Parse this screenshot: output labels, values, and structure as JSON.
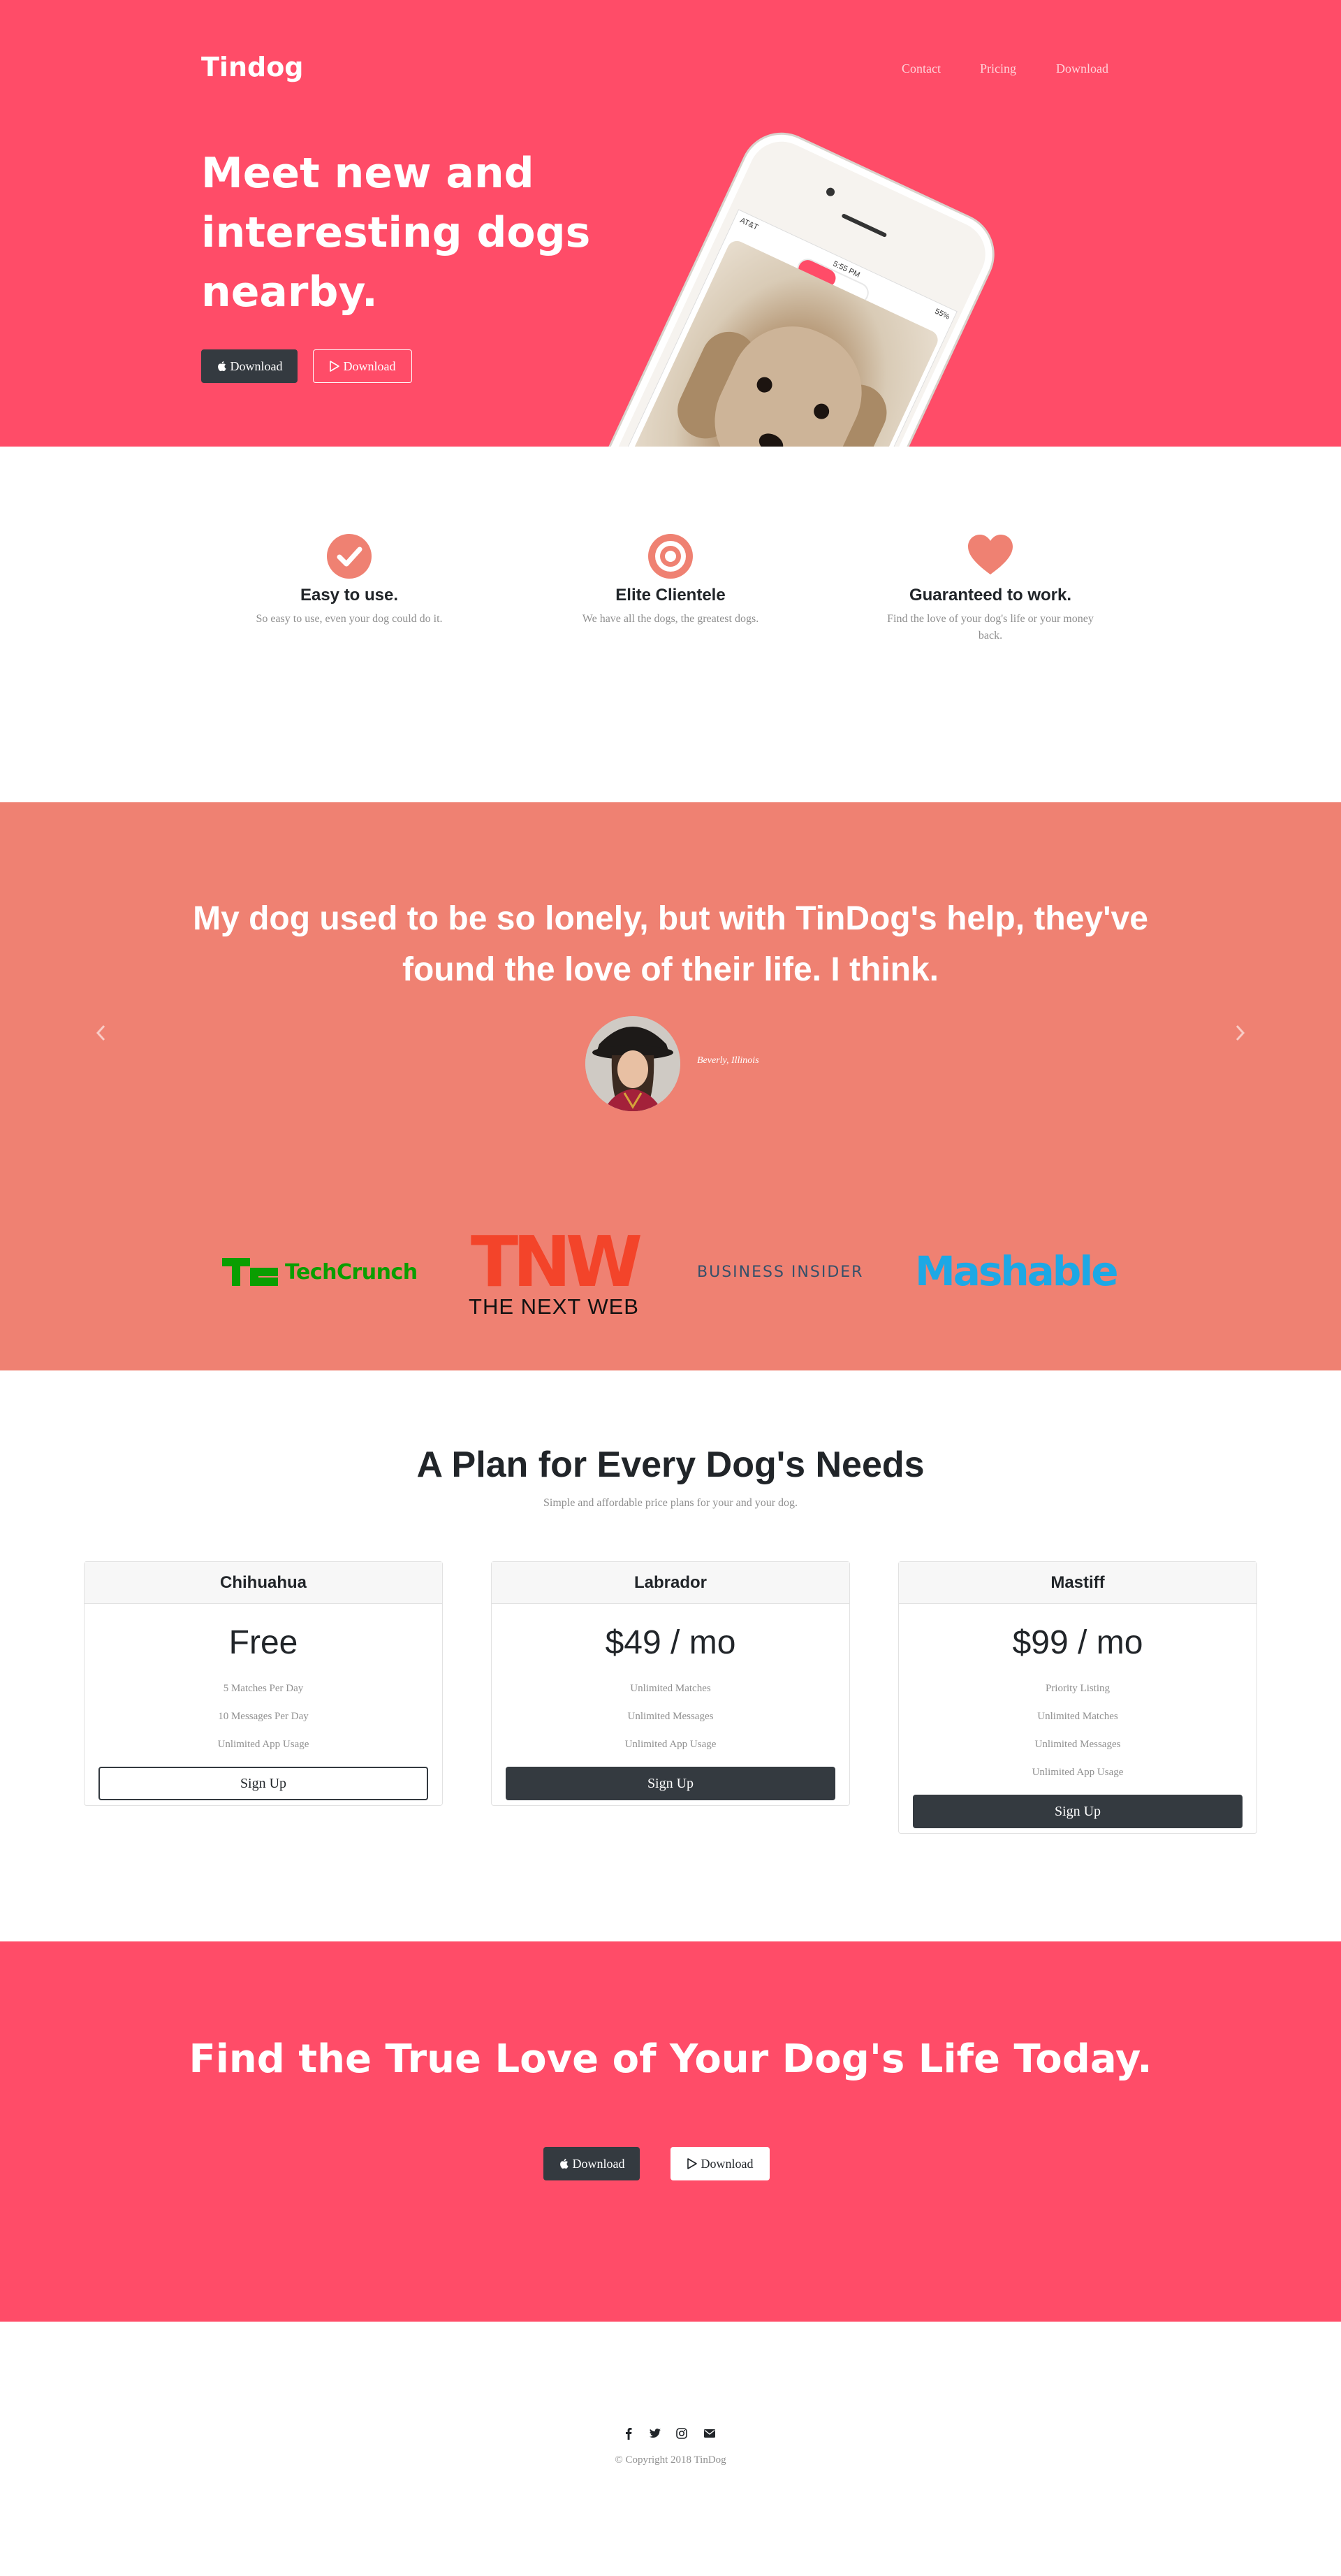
{
  "brand": "Tindog",
  "nav": {
    "contact": "Contact",
    "pricing": "Pricing",
    "download": "Download"
  },
  "hero": {
    "heading": "Meet new and interesting dogs nearby.",
    "download_apple": "Download",
    "download_play": "Download"
  },
  "phone": {
    "carrier": "AT&T",
    "time": "5:55 PM",
    "battery": "55%"
  },
  "features": [
    {
      "title": "Easy to use.",
      "text": "So easy to use, even your dog could do it.",
      "icon": "check-circle-icon"
    },
    {
      "title": "Elite Clientele",
      "text": "We have all the dogs, the greatest dogs.",
      "icon": "bullseye-icon"
    },
    {
      "title": "Guaranteed to work.",
      "text": "Find the love of your dog's life or your money back.",
      "icon": "heart-icon"
    }
  ],
  "testimonial": {
    "quote": "My dog used to be so lonely, but with TinDog's help, they've found the love of their life. I think.",
    "caption": "Beverly, Illinois"
  },
  "press": {
    "techcrunch": "TechCrunch",
    "tnw": "TNW",
    "tnw_sub": "THE NEXT WEB",
    "business_insider": "BUSINESS INSIDER",
    "mashable": "Mashable"
  },
  "pricing": {
    "title": "A Plan for Every Dog's Needs",
    "subtitle": "Simple and affordable price plans for your and your dog.",
    "plans": [
      {
        "name": "Chihuahua",
        "price": "Free",
        "features": [
          "5 Matches Per Day",
          "10 Messages Per Day",
          "Unlimited App Usage"
        ],
        "button": "Sign Up"
      },
      {
        "name": "Labrador",
        "price": "$49 / mo",
        "features": [
          "Unlimited Matches",
          "Unlimited Messages",
          "Unlimited App Usage"
        ],
        "button": "Sign Up"
      },
      {
        "name": "Mastiff",
        "price": "$99 / mo",
        "features": [
          "Priority Listing",
          "Unlimited Matches",
          "Unlimited Messages",
          "Unlimited App Usage"
        ],
        "button": "Sign Up"
      }
    ]
  },
  "cta": {
    "heading": "Find the True Love of Your Dog's Life Today.",
    "download_apple": "Download",
    "download_play": "Download"
  },
  "footer": {
    "copyright": "© Copyright 2018 TinDog",
    "icons": [
      "facebook-icon",
      "twitter-icon",
      "instagram-icon",
      "envelope-icon"
    ]
  },
  "colors": {
    "primary": "#ff4c68",
    "testimonial_bg": "#ef8172",
    "feature_icon": "#ef8172",
    "dark_button": "#343a40"
  }
}
